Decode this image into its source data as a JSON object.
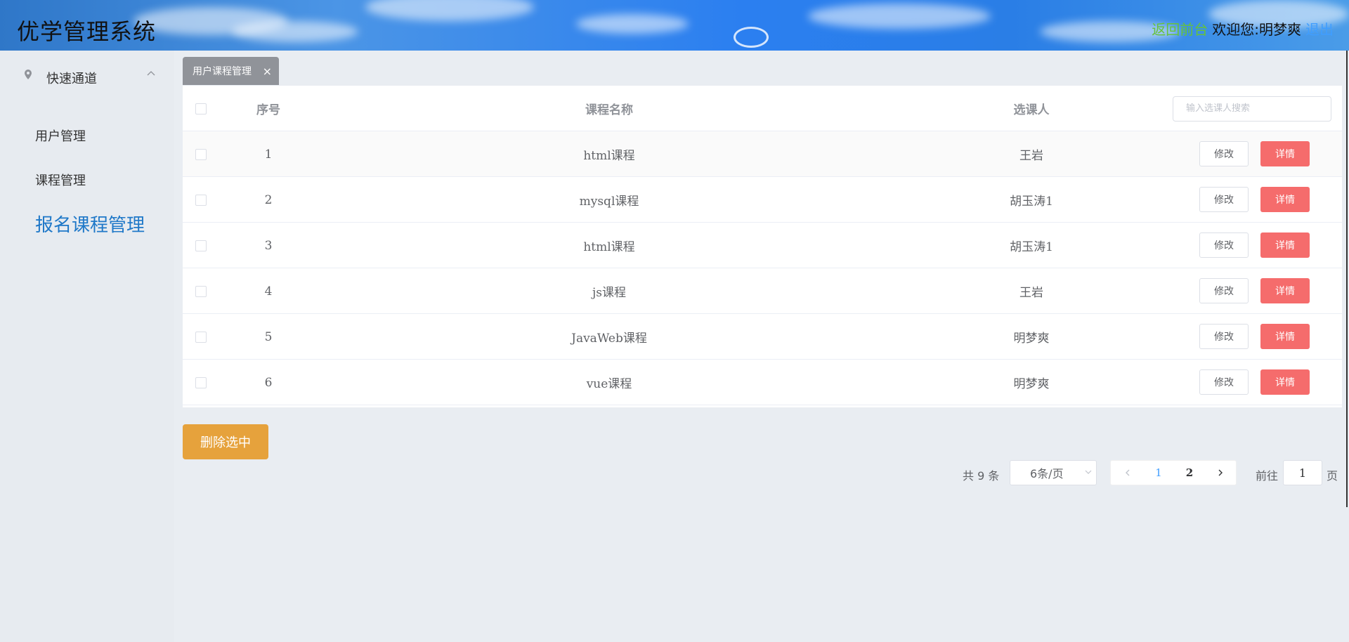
{
  "header": {
    "title": "优学管理系统",
    "back_to_front": "返回前台",
    "welcome": "欢迎您:明梦爽",
    "logout": "退出"
  },
  "sidebar": {
    "group_title": "快速通道",
    "items": [
      {
        "label": "用户管理"
      },
      {
        "label": "课程管理"
      },
      {
        "label": "报名课程管理"
      }
    ]
  },
  "tab": {
    "label": "用户课程管理",
    "close": "×"
  },
  "table": {
    "headers": {
      "no": "序号",
      "course": "课程名称",
      "person": "选课人"
    },
    "search_placeholder": "输入选课人搜索",
    "edit_label": "修改",
    "detail_label": "详情",
    "rows": [
      {
        "no": "1",
        "course": "html课程",
        "person": "王岩"
      },
      {
        "no": "2",
        "course": "mysql课程",
        "person": "胡玉涛1"
      },
      {
        "no": "3",
        "course": "html课程",
        "person": "胡玉涛1"
      },
      {
        "no": "4",
        "course": "js课程",
        "person": "王岩"
      },
      {
        "no": "5",
        "course": "JavaWeb课程",
        "person": "明梦爽"
      },
      {
        "no": "6",
        "course": "vue课程",
        "person": "明梦爽"
      }
    ]
  },
  "actions": {
    "delete_selected": "删除选中"
  },
  "pagination": {
    "total": "共 9 条",
    "page_size": "6条/页",
    "pages": [
      "1",
      "2"
    ],
    "current_page": "1",
    "goto_label": "前往",
    "goto_value": "1",
    "goto_suffix": "页"
  },
  "colors": {
    "accent": "#409eff",
    "danger": "#f56c6c",
    "warning": "#e6a23c",
    "success": "#67c23a"
  }
}
